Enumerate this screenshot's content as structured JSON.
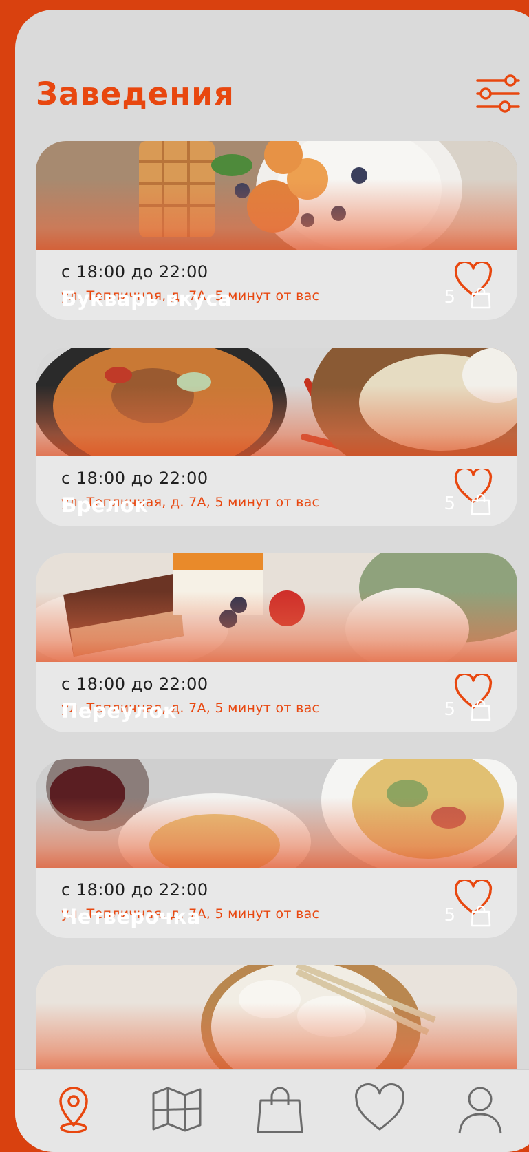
{
  "header": {
    "title": "Заведения",
    "filter_icon": "filter-sliders-icon"
  },
  "colors": {
    "accent": "#e8470f",
    "frame": "#d9410f",
    "background": "#dadada",
    "card": "#e8e8e8",
    "text": "#1f1f1f",
    "tab_inactive": "#6b6b6b"
  },
  "venues": [
    {
      "name": "Букварь вкуса",
      "count": "5",
      "hours": "с 18:00 до 22:00",
      "address": "ул. Тепличная, д. 7А, 5 минут от вас",
      "photo": "waffles-with-fruit-and-yogurt"
    },
    {
      "name": "Брелок",
      "count": "5",
      "hours": "с 18:00 до 22:00",
      "address": "ул. Тепличная, д. 7А, 5 минут от вас",
      "photo": "curry-stew-with-chili"
    },
    {
      "name": "Переулок",
      "count": "5",
      "hours": "с 18:00 до 22:00",
      "address": "ул. Тепличная, д. 7А, 5 минут от вас",
      "photo": "cake-slices-with-strawberry"
    },
    {
      "name": "Четверочка",
      "count": "5",
      "hours": "с 18:00 до 22:00",
      "address": "ул. Тепличная, д. 7А, 5 минут от вас",
      "photo": "pasta-and-wine"
    },
    {
      "name": "",
      "photo": "dumplings-with-chopsticks"
    }
  ],
  "tabbar": {
    "tabs": [
      {
        "icon": "map-pin-icon",
        "active": true
      },
      {
        "icon": "map-icon",
        "active": false
      },
      {
        "icon": "shopping-bag-icon",
        "active": false
      },
      {
        "icon": "heart-icon",
        "active": false
      },
      {
        "icon": "profile-icon",
        "active": false
      }
    ]
  }
}
